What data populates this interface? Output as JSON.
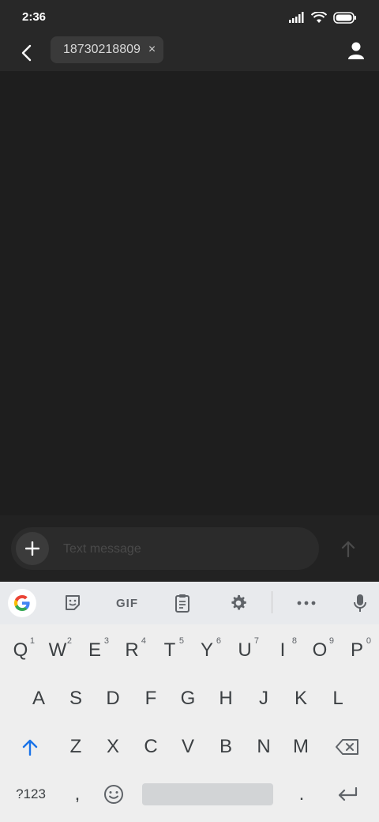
{
  "status": {
    "time": "2:36"
  },
  "header": {
    "recipient": "18730218809",
    "remove_symbol": "×"
  },
  "composer": {
    "placeholder": "Text message"
  },
  "keyboard": {
    "toolbar": {
      "gif_label": "GIF"
    },
    "row1": [
      {
        "label": "Q",
        "hint": "1"
      },
      {
        "label": "W",
        "hint": "2"
      },
      {
        "label": "E",
        "hint": "3"
      },
      {
        "label": "R",
        "hint": "4"
      },
      {
        "label": "T",
        "hint": "5"
      },
      {
        "label": "Y",
        "hint": "6"
      },
      {
        "label": "U",
        "hint": "7"
      },
      {
        "label": "I",
        "hint": "8"
      },
      {
        "label": "O",
        "hint": "9"
      },
      {
        "label": "P",
        "hint": "0"
      }
    ],
    "row2": [
      "A",
      "S",
      "D",
      "F",
      "G",
      "H",
      "J",
      "K",
      "L"
    ],
    "row3": [
      "Z",
      "X",
      "C",
      "V",
      "B",
      "N",
      "M"
    ],
    "bottom": {
      "symbols_label": "?123",
      "comma": ",",
      "period": "."
    }
  },
  "colors": {
    "accent_blue": "#1a73e8",
    "background": "#1e1e1e",
    "keyboard_bg": "#eeeeee"
  },
  "icons": [
    "back-arrow-icon",
    "contact-icon",
    "plus-icon",
    "send-arrow-icon",
    "google-icon",
    "sticker-icon",
    "clipboard-icon",
    "gear-icon",
    "more-icon",
    "mic-icon",
    "shift-icon",
    "backspace-icon",
    "emoji-icon",
    "enter-icon",
    "signal-icon",
    "wifi-icon",
    "battery-icon"
  ]
}
